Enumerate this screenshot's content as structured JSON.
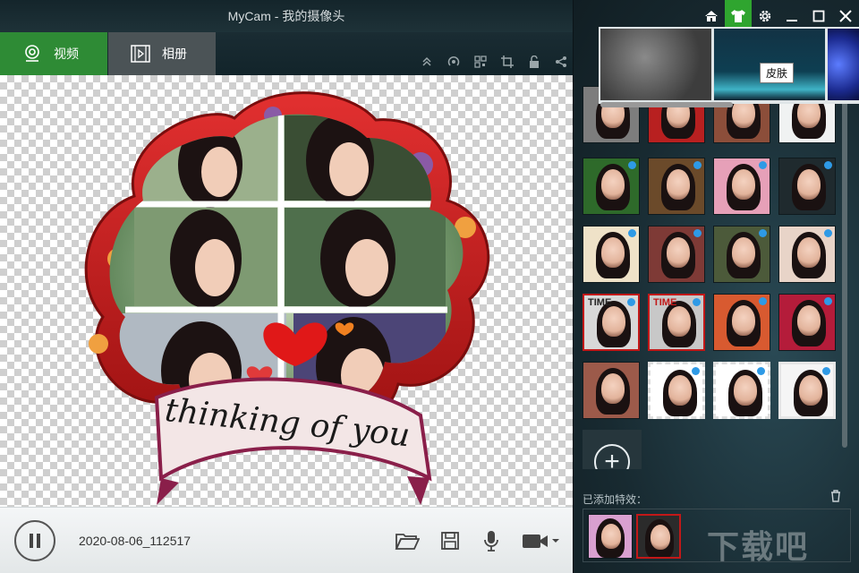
{
  "window": {
    "title": "MyCam - 我的摄像头"
  },
  "modes": [
    {
      "label": "视频",
      "icon": "webcam-icon",
      "active": true
    },
    {
      "label": "相册",
      "icon": "film-icon",
      "active": false
    }
  ],
  "preview_tools": [
    "collapse-icon",
    "broadcast-icon",
    "qrcode-icon",
    "crop-icon",
    "lock-icon",
    "share-icon"
  ],
  "preview": {
    "caption": "thinking of you",
    "frame": "cloud-heart-frame"
  },
  "bottom": {
    "timestamp": "2020-08-06_112517",
    "buttons": [
      "folder-open-icon",
      "save-icon",
      "microphone-icon",
      "video-camera-icon"
    ]
  },
  "right_panel": {
    "window_buttons": [
      "home-icon",
      "skin-icon",
      "settings-icon",
      "minimize-icon",
      "maximize-icon",
      "close-icon"
    ],
    "skin_tooltip": "皮肤",
    "effect_labels": {
      "time1": "TIME",
      "time2": "TIME"
    },
    "added_effects_label": "已添加特效：",
    "add_button": "+"
  },
  "watermark": "下载吧",
  "colors": {
    "accent_green": "#2e8b35",
    "selected_dot": "#2e9ae6",
    "frame_red": "#c81e1e"
  }
}
